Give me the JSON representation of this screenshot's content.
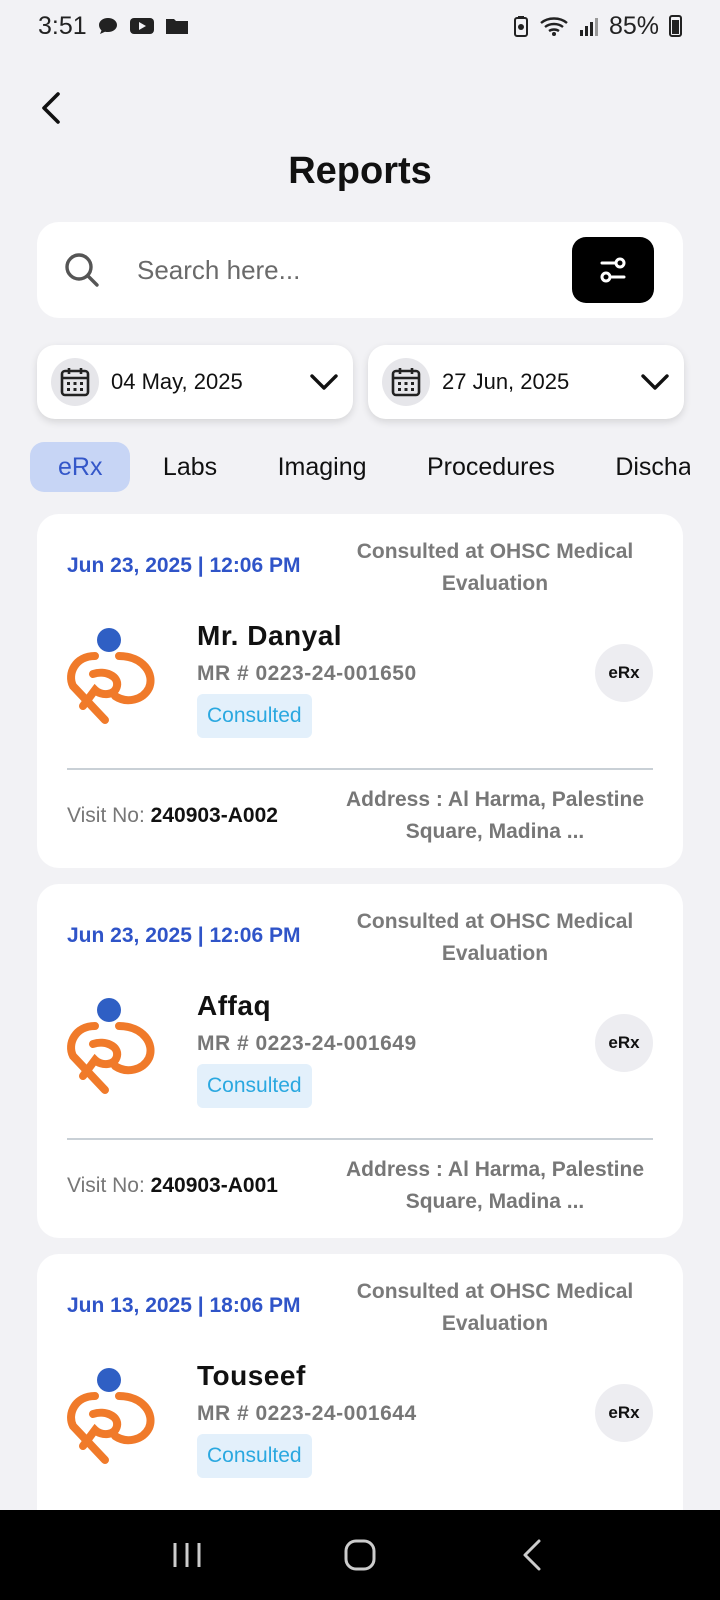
{
  "status_bar": {
    "time": "3:51",
    "battery": "85%"
  },
  "header": {
    "title": "Reports"
  },
  "search": {
    "placeholder": "Search here..."
  },
  "date_range": {
    "from": "04 May, 2025",
    "to": "27 Jun, 2025"
  },
  "tabs": [
    {
      "label": "eRx",
      "active": true
    },
    {
      "label": "Labs"
    },
    {
      "label": "Imaging"
    },
    {
      "label": "Procedures"
    },
    {
      "label": "Discharge"
    }
  ],
  "reports": [
    {
      "datetime": "Jun 23, 2025 | 12:06 PM",
      "location": "Consulted at OHSC Medical Evaluation",
      "name": "Mr. Danyal",
      "mr": "MR # 0223-24-001650",
      "status": "Consulted",
      "type": "eRx",
      "visit_label": "Visit No: ",
      "visit_no": "240903-A002",
      "address": "Address : Al Harma, Palestine Square, Madina ..."
    },
    {
      "datetime": "Jun 23, 2025 | 12:06 PM",
      "location": "Consulted at OHSC Medical Evaluation",
      "name": " Affaq",
      "mr": "MR # 0223-24-001649",
      "status": "Consulted",
      "type": "eRx",
      "visit_label": "Visit No: ",
      "visit_no": "240903-A001",
      "address": "Address : Al Harma, Palestine Square, Madina ..."
    },
    {
      "datetime": "Jun 13, 2025 | 18:06 PM",
      "location": "Consulted at OHSC Medical Evaluation",
      "name": " Touseef",
      "mr": "MR # 0223-24-001644",
      "status": "Consulted",
      "type": "eRx"
    }
  ],
  "colors": {
    "accent": "#2f54c8",
    "tab_active_bg": "#c7d5f5",
    "badge_text": "#2aa8e0",
    "logo_orange": "#f07a2a",
    "logo_blue": "#2f5fc4"
  }
}
